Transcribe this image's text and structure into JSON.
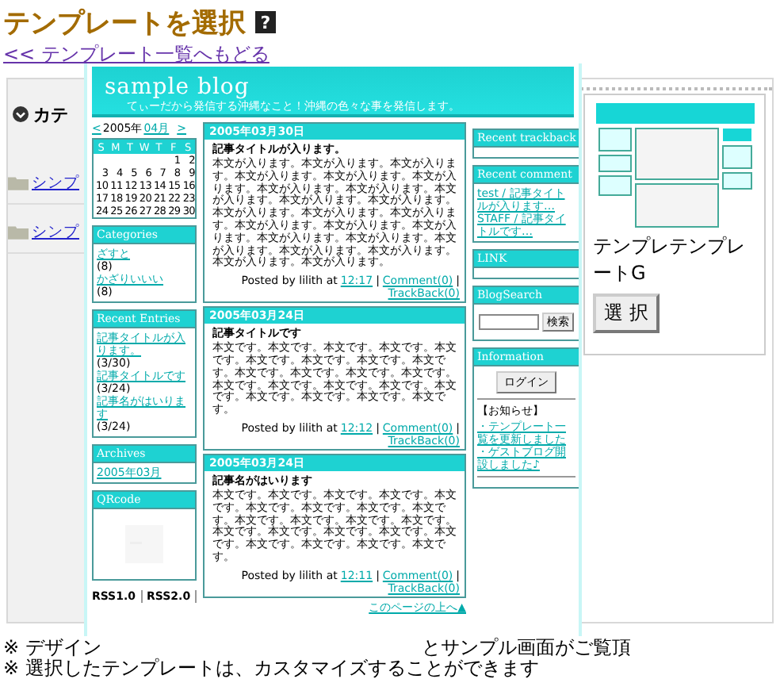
{
  "page": {
    "title": "テンプレートを選択",
    "help_icon": "?",
    "back_link": "<< テンプレート一覧へもどる"
  },
  "category_panel": {
    "heading": "カテ",
    "items": [
      {
        "label": "シンプ"
      },
      {
        "label": "シンプ"
      }
    ]
  },
  "template_card": {
    "name": "テンプレテンプレートG",
    "select_button": "選 択"
  },
  "notes": [
    {
      "parts": [
        "※ デザイン",
        "とサンプル画面がご覧頂"
      ]
    },
    {
      "parts": [
        "※ 選択したテンプレートは、カスタマイズすることができます"
      ]
    }
  ],
  "preview": {
    "blog_title": "sample blog",
    "blog_subtitle": "てぃーだから発信する沖縄なこと！沖縄の色々な事を発信します。",
    "calendar": {
      "prev": "<",
      "year": "2005年",
      "month": "04月",
      "next": ">",
      "weekdays": [
        "S",
        "M",
        "T",
        "W",
        "T",
        "F",
        "S"
      ],
      "weeks": [
        [
          "1",
          "2"
        ],
        [
          "3",
          "4",
          "5",
          "6",
          "7",
          "8",
          "9"
        ],
        [
          "10",
          "11",
          "12",
          "13",
          "14",
          "15",
          "16"
        ],
        [
          "17",
          "18",
          "19",
          "20",
          "21",
          "22",
          "23"
        ],
        [
          "24",
          "25",
          "26",
          "27",
          "28",
          "29",
          "30"
        ]
      ]
    },
    "left_boxes": [
      {
        "kind": "links",
        "title": "Categories",
        "items": [
          {
            "link": "ざすと",
            "count": "(8)"
          },
          {
            "link": "かざりいいい",
            "count": "(8)"
          }
        ]
      },
      {
        "kind": "links",
        "title": "Recent Entries",
        "items": [
          {
            "link": "記事タイトルが入ります。",
            "count": "(3/30)"
          },
          {
            "link": "記事タイトルです",
            "count": "(3/24)"
          },
          {
            "link": "記事名がはいります",
            "count": "(3/24)"
          }
        ]
      },
      {
        "kind": "links",
        "title": "Archives",
        "items": [
          {
            "link": "2005年03月"
          }
        ]
      },
      {
        "kind": "qr",
        "title": "QRcode"
      }
    ],
    "rss": [
      "RSS1.0",
      "RSS2.0"
    ],
    "posts": [
      {
        "date": "2005年03月30日",
        "title": "記事タイトルが入ります。",
        "body": "本文が入ります。本文が入ります。本文が入ります。本文が入ります。本文が入ります。本文が入ります。本文が入ります。本文が入ります。本文が入ります。本文が入ります。本文が入ります。本文が入ります。本文が入ります。本文が入ります。本文が入ります。本文が入ります。本文が入ります。本文が入ります。本文が入ります。本文が入ります。本文が入ります。本文が入ります。本文が入ります。本文が入ります。",
        "footer": [
          {
            "kind": "text",
            "text": "Posted by lilith at"
          },
          {
            "kind": "link",
            "text": "12:17"
          },
          {
            "kind": "sep",
            "text": "|"
          },
          {
            "kind": "link",
            "text": "Comment(0)"
          },
          {
            "kind": "sep",
            "text": "|"
          },
          {
            "kind": "link",
            "text": "TrackBack(0)"
          }
        ]
      },
      {
        "date": "2005年03月24日",
        "title": "記事タイトルです",
        "body": "本文です。本文です。本文です。本文です。本文です。本文です。本文です。本文です。本文です。本文です。本文です。本文です。本文です。本文です。本文です。本文です。本文です。本文です。本文です。本文です。本文です。本文です。",
        "footer": [
          {
            "kind": "text",
            "text": "Posted by lilith at"
          },
          {
            "kind": "link",
            "text": "12:12"
          },
          {
            "kind": "sep",
            "text": "|"
          },
          {
            "kind": "link",
            "text": "Comment(0)"
          },
          {
            "kind": "sep",
            "text": "|"
          },
          {
            "kind": "link",
            "text": "TrackBack(0)"
          }
        ]
      },
      {
        "date": "2005年03月24日",
        "title": "記事名がはいります",
        "body": "本文です。本文です。本文です。本文です。本文です。本文です。本文です。本文です。本文です。本文です。本文です。本文です。本文です。本文です。本文です。本文です。本文です。本文です。本文です。本文です。本文です。本文です。",
        "footer": [
          {
            "kind": "text",
            "text": "Posted by lilith at"
          },
          {
            "kind": "link",
            "text": "12:11"
          },
          {
            "kind": "sep",
            "text": "|"
          },
          {
            "kind": "link",
            "text": "Comment(0)"
          },
          {
            "kind": "sep",
            "text": "|"
          },
          {
            "kind": "link",
            "text": "TrackBack(0)"
          }
        ]
      }
    ],
    "page_top_link": "このページの上へ▲",
    "right_boxes": [
      {
        "kind": "empty",
        "title": "Recent trackback"
      },
      {
        "kind": "comments",
        "title": "Recent comment",
        "items": [
          "test / 記事タイトルが入ります…",
          "STAFF / 記事タイトルです…"
        ]
      },
      {
        "kind": "empty",
        "title": "LINK"
      },
      {
        "kind": "search",
        "title": "BlogSearch",
        "button": "検索"
      },
      {
        "kind": "info",
        "title": "Information",
        "button": "ログイン",
        "notice": "【お知らせ】",
        "links": [
          "・テンプレート一覧を更新しました",
          "・ゲストブログ開設しました♪"
        ]
      }
    ]
  }
}
